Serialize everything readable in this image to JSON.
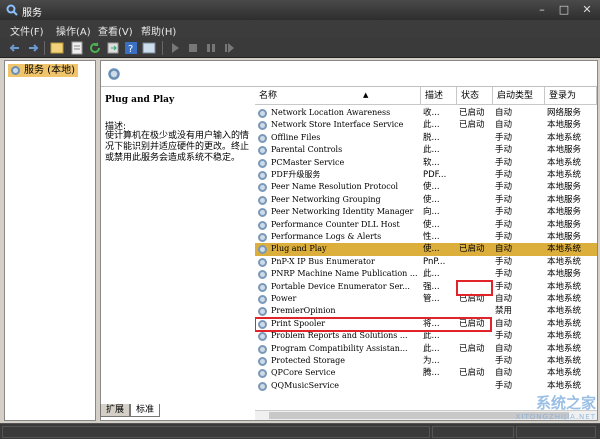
{
  "window": {
    "title": "服务"
  },
  "menu": [
    "文件(F)",
    "操作(A)",
    "查看(V)",
    "帮助(H)"
  ],
  "tree": {
    "root": "服务 (本地)"
  },
  "description": {
    "service_name": "Plug and Play",
    "label": "描述:",
    "text": "使计算机在极少或没有用户输入的情况下能识别并适应硬件的更改。终止或禁用此服务会造成系统不稳定。"
  },
  "columns": {
    "name": "名称",
    "desc": "描述",
    "status": "状态",
    "startup": "启动类型",
    "logon": "登录为"
  },
  "services": [
    {
      "name": "Network Location Awareness",
      "desc": "收...",
      "status": "已启动",
      "startup": "自动",
      "logon": "网络服务"
    },
    {
      "name": "Network Store Interface Service",
      "desc": "此...",
      "status": "已启动",
      "startup": "自动",
      "logon": "本地服务"
    },
    {
      "name": "Offline Files",
      "desc": "脱...",
      "status": "",
      "startup": "手动",
      "logon": "本地系统"
    },
    {
      "name": "Parental Controls",
      "desc": "此...",
      "status": "",
      "startup": "手动",
      "logon": "本地服务"
    },
    {
      "name": "PCMaster Service",
      "desc": "软...",
      "status": "",
      "startup": "手动",
      "logon": "本地系统"
    },
    {
      "name": "PDF升级服务",
      "desc": "PDF...",
      "status": "",
      "startup": "手动",
      "logon": "本地系统"
    },
    {
      "name": "Peer Name Resolution Protocol",
      "desc": "使...",
      "status": "",
      "startup": "手动",
      "logon": "本地服务"
    },
    {
      "name": "Peer Networking Grouping",
      "desc": "使...",
      "status": "",
      "startup": "手动",
      "logon": "本地服务"
    },
    {
      "name": "Peer Networking Identity Manager",
      "desc": "向...",
      "status": "",
      "startup": "手动",
      "logon": "本地服务"
    },
    {
      "name": "Performance Counter DLL Host",
      "desc": "使...",
      "status": "",
      "startup": "手动",
      "logon": "本地服务"
    },
    {
      "name": "Performance Logs & Alerts",
      "desc": "性...",
      "status": "",
      "startup": "手动",
      "logon": "本地服务"
    },
    {
      "name": "Plug and Play",
      "desc": "使...",
      "status": "已启动",
      "startup": "自动",
      "logon": "本地系统"
    },
    {
      "name": "PnP-X IP Bus Enumerator",
      "desc": "PnP...",
      "status": "",
      "startup": "手动",
      "logon": "本地系统"
    },
    {
      "name": "PNRP Machine Name Publication ...",
      "desc": "此...",
      "status": "",
      "startup": "手动",
      "logon": "本地服务"
    },
    {
      "name": "Portable Device Enumerator Ser...",
      "desc": "强...",
      "status": "",
      "startup": "手动",
      "logon": "本地系统"
    },
    {
      "name": "Power",
      "desc": "管...",
      "status": "已启动",
      "startup": "自动",
      "logon": "本地系统"
    },
    {
      "name": "PremierOpinion",
      "desc": "",
      "status": "",
      "startup": "禁用",
      "logon": "本地系统"
    },
    {
      "name": "Print Spooler",
      "desc": "将...",
      "status": "已启动",
      "startup": "自动",
      "logon": "本地系统"
    },
    {
      "name": "Problem Reports and Solutions ...",
      "desc": "此...",
      "status": "",
      "startup": "手动",
      "logon": "本地系统"
    },
    {
      "name": "Program Compatibility Assistan...",
      "desc": "此...",
      "status": "已启动",
      "startup": "自动",
      "logon": "本地系统"
    },
    {
      "name": "Protected Storage",
      "desc": "为...",
      "status": "",
      "startup": "手动",
      "logon": "本地系统"
    },
    {
      "name": "QPCore Service",
      "desc": "腾...",
      "status": "已启动",
      "startup": "自动",
      "logon": "本地系统"
    },
    {
      "name": "QQMusicService",
      "desc": "",
      "status": "",
      "startup": "手动",
      "logon": "本地系统"
    }
  ],
  "selected_service": "Plug and Play",
  "tabs": [
    "扩展",
    "标准"
  ],
  "watermark": {
    "main": "系统之家",
    "sub": "XITONGZHIJIA.NET"
  },
  "colors": {
    "selected_row": "#dcae3c",
    "highlight_box": "#e0242a",
    "tree_selected": "#f0c46b"
  }
}
